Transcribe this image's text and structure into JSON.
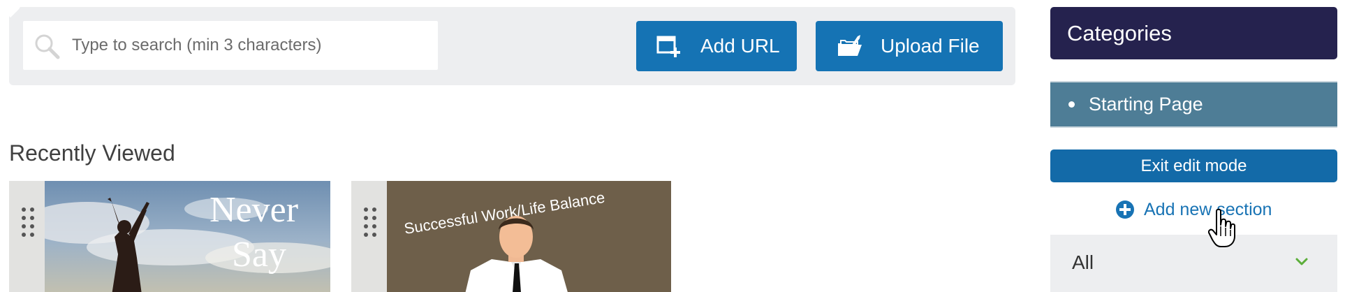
{
  "search": {
    "placeholder": "Type to search (min 3 characters)",
    "value": ""
  },
  "toolbar": {
    "add_url_label": "Add URL",
    "add_url_icon": "add-window-icon",
    "upload_label": "Upload File",
    "upload_icon": "folder-upload-icon",
    "button_color": "#1573b4"
  },
  "recently_viewed": {
    "title": "Recently Viewed",
    "cards": [
      {
        "thumb_text_line1": "Never",
        "thumb_text_line2": "Say",
        "favorite_icon": "heart-icon"
      },
      {
        "thumb_text": "Successful Work/Life Balance",
        "favorite_icon": "heart-icon"
      }
    ]
  },
  "sidebar": {
    "categories_title": "Categories",
    "header_color": "#25224e",
    "items": [
      {
        "label": "Starting Page",
        "color": "#4e7d96"
      }
    ],
    "exit_edit_label": "Exit edit mode",
    "add_section_label": "Add new section",
    "add_section_icon": "plus-circle-icon",
    "filter": {
      "selected": "All",
      "icon": "chevron-down-icon",
      "chevron_color": "#5cae3a"
    }
  },
  "cursor": {
    "icon": "hand-pointer-icon"
  }
}
